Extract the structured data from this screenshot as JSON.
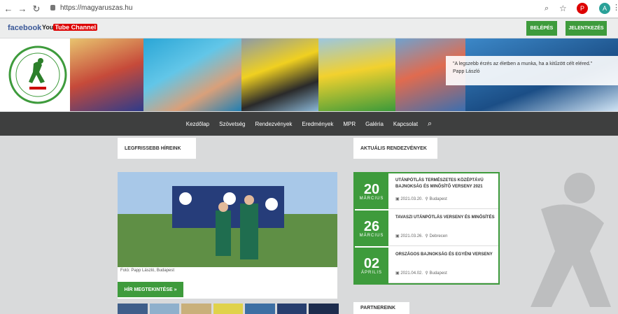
{
  "browser": {
    "url": "https://magyaruszas.hu"
  },
  "topbar": {
    "facebook": "facebook",
    "youtube_a": "You",
    "youtube_b": "Tube Channel",
    "btn1": "BELÉPÉS",
    "btn2": "JELENTKEZÉS"
  },
  "hero": {
    "quote": "\"A legszebb érzés az életben a munka, ha a kitűzött célt eléred.\"",
    "quote_author": "Papp László"
  },
  "nav": {
    "items": [
      "Kezdőlap",
      "Szövetség",
      "Rendezvények",
      "Eredmények",
      "MPR",
      "Galéria",
      "Kapcsolat"
    ]
  },
  "sections": {
    "news_title": "LEGFRISSEBB HÍREINK",
    "events_title": "AKTUÁLIS RENDEZVÉNYEK",
    "sponsors_title": "PARTNEREINK"
  },
  "news": {
    "caption": "Fotó: Papp László, Budapest",
    "more": "HÍR MEGTEKINTÉSE »"
  },
  "events": [
    {
      "day": "20",
      "month": "MÁRCIUS",
      "title": "UTÁNPÓTLÁS TERMÉSZETES KÖZÉPTÁVÚ BAJNOKSÁG ÉS MINŐSÍTŐ VERSENY 2021",
      "time": "2021.03.20.",
      "place": "Budapest"
    },
    {
      "day": "26",
      "month": "MÁRCIUS",
      "title": "TAVASZI UTÁNPÓTLÁS VERSENY ÉS MINŐSÍTÉS",
      "time": "2021.03.26.",
      "place": "Debrecen"
    },
    {
      "day": "02",
      "month": "ÁPRILIS",
      "title": "ORSZÁGOS BAJNOKSÁG ÉS EGYÉNI VERSENY",
      "time": "2021.04.02.",
      "place": "Budapest"
    }
  ],
  "colors": {
    "green": "#3e9b3c",
    "nav": "#3e3f3f"
  }
}
